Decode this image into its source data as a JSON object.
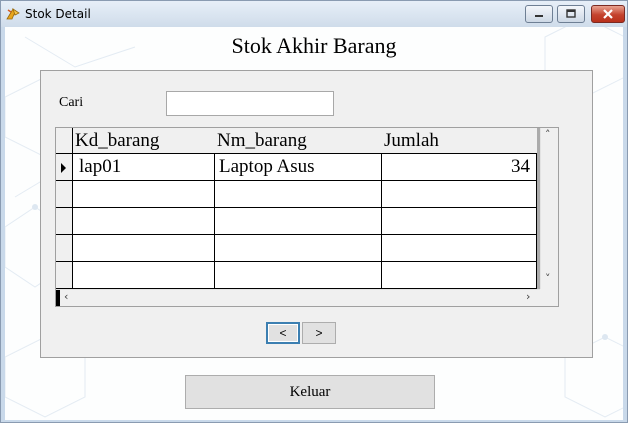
{
  "window": {
    "title": "Stok Detail",
    "controls": {
      "minimize": "minimize",
      "maximize": "maximize",
      "close": "close"
    }
  },
  "heading": "Stok Akhir Barang",
  "search": {
    "label": "Cari",
    "value": ""
  },
  "table": {
    "columns": [
      "Kd_barang",
      "Nm_barang",
      "Jumlah"
    ],
    "rows": [
      {
        "kd": "lap01",
        "nm": "Laptop Asus",
        "jumlah": "34"
      },
      {
        "kd": "",
        "nm": "",
        "jumlah": ""
      },
      {
        "kd": "",
        "nm": "",
        "jumlah": ""
      },
      {
        "kd": "",
        "nm": "",
        "jumlah": ""
      },
      {
        "kd": "",
        "nm": "",
        "jumlah": ""
      }
    ]
  },
  "pager": {
    "prev": "<",
    "next": ">"
  },
  "exit_button": "Keluar",
  "colors": {
    "accent": "#3c7fb1",
    "close_button": "#c4432e",
    "panel": "#f0f0f0"
  }
}
